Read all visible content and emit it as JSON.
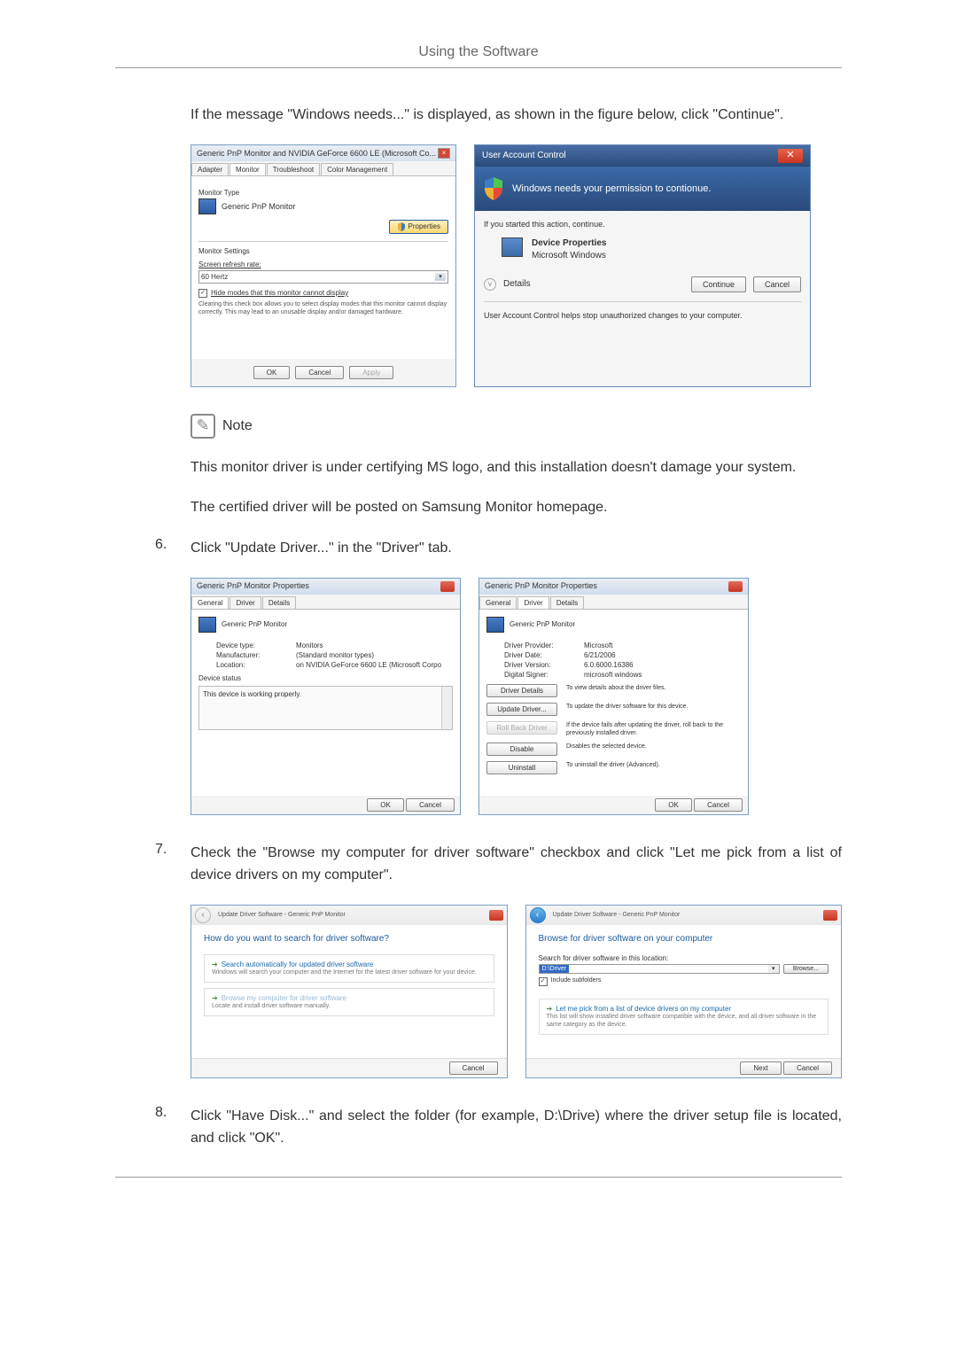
{
  "header": {
    "title": "Using the Software"
  },
  "intro_paragraph": "If the message \"Windows needs...\" is displayed, as shown in the figure below, click \"Continue\".",
  "monitor_dialog": {
    "title": "Generic PnP Monitor and NVIDIA GeForce 6600 LE (Microsoft Co...",
    "tabs": [
      "Adapter",
      "Monitor",
      "Troubleshoot",
      "Color Management"
    ],
    "monitor_type_label": "Monitor Type",
    "monitor_name": "Generic PnP Monitor",
    "properties_btn": "Properties",
    "settings_label": "Monitor Settings",
    "refresh_label": "Screen refresh rate:",
    "refresh_value": "60 Hertz",
    "hide_modes_label": "Hide modes that this monitor cannot display",
    "hide_modes_hint": "Clearing this check box allows you to select display modes that this monitor cannot display correctly. This may lead to an unusable display and/or damaged hardware.",
    "ok": "OK",
    "cancel": "Cancel",
    "apply": "Apply"
  },
  "uac_dialog": {
    "title": "User Account Control",
    "banner": "Windows needs your permission to contionue.",
    "started_line": "If you started this action, continue.",
    "app_title": "Device Properties",
    "app_publisher": "Microsoft Windows",
    "details": "Details",
    "continue_btn": "Continue",
    "cancel_btn": "Cancel",
    "footer": "User Account Control helps stop unauthorized changes to your computer."
  },
  "note": {
    "label": "Note",
    "p1": "This monitor driver is under certifying MS logo, and this installation doesn't damage your system.",
    "p2": "The certified driver will be posted on Samsung Monitor homepage."
  },
  "step6": {
    "num": "6.",
    "text": "Click \"Update Driver...\" in the \"Driver\" tab."
  },
  "props_general": {
    "title": "Generic PnP Monitor Properties",
    "tabs": [
      "General",
      "Driver",
      "Details"
    ],
    "monitor_name": "Generic PnP Monitor",
    "device_type_k": "Device type:",
    "device_type_v": "Monitors",
    "manufacturer_k": "Manufacturer:",
    "manufacturer_v": "(Standard monitor types)",
    "location_k": "Location:",
    "location_v": "on NVIDIA GeForce 6600 LE (Microsoft Corpo",
    "status_label": "Device status",
    "status_text": "This device is working properly.",
    "ok": "OK",
    "cancel": "Cancel"
  },
  "props_driver": {
    "title": "Generic PnP Monitor Properties",
    "tabs": [
      "General",
      "Driver",
      "Details"
    ],
    "monitor_name": "Generic PnP Monitor",
    "provider_k": "Driver Provider:",
    "provider_v": "Microsoft",
    "date_k": "Driver Date:",
    "date_v": "6/21/2006",
    "version_k": "Driver Version:",
    "version_v": "6.0.6000.16386",
    "signer_k": "Digital Signer:",
    "signer_v": "microsoft windows",
    "details_btn": "Driver Details",
    "details_desc": "To view details about the driver files.",
    "update_btn": "Update Driver...",
    "update_desc": "To update the driver software for this device.",
    "rollback_btn": "Roll Back Driver",
    "rollback_desc": "If the device fails after updating the driver, roll back to the previously installed driver.",
    "disable_btn": "Disable",
    "disable_desc": "Disables the selected device.",
    "uninstall_btn": "Uninstall",
    "uninstall_desc": "To uninstall the driver (Advanced).",
    "ok": "OK",
    "cancel": "Cancel"
  },
  "step7": {
    "num": "7.",
    "text": "Check the \"Browse my computer for driver software\" checkbox and click \"Let me pick from a list of device drivers on my computer\"."
  },
  "wizard_left": {
    "breadcrumb": "Update Driver Software - Generic PnP Monitor",
    "heading": "How do you want to search for driver software?",
    "opt1_title": "Search automatically for updated driver software",
    "opt1_desc": "Windows will search your computer and the Internet for the latest driver software for your device.",
    "opt2_title": "Browse my computer for driver software",
    "opt2_desc": "Locate and install driver software manually.",
    "cancel": "Cancel"
  },
  "wizard_right": {
    "breadcrumb": "Update Driver Software - Generic PnP Monitor",
    "heading": "Browse for driver software on your computer",
    "search_label": "Search for driver software in this location:",
    "location_value": "D:\\Driver",
    "browse_btn": "Browse...",
    "include_sub": "Include subfolders",
    "opt_title": "Let me pick from a list of device drivers on my computer",
    "opt_desc": "This list will show installed driver software compatible with the device, and all driver software in the same category as the device.",
    "next": "Next",
    "cancel": "Cancel"
  },
  "step8": {
    "num": "8.",
    "text": "Click \"Have Disk...\" and select the folder (for example, D:\\Drive) where the driver setup file is located, and click \"OK\"."
  }
}
